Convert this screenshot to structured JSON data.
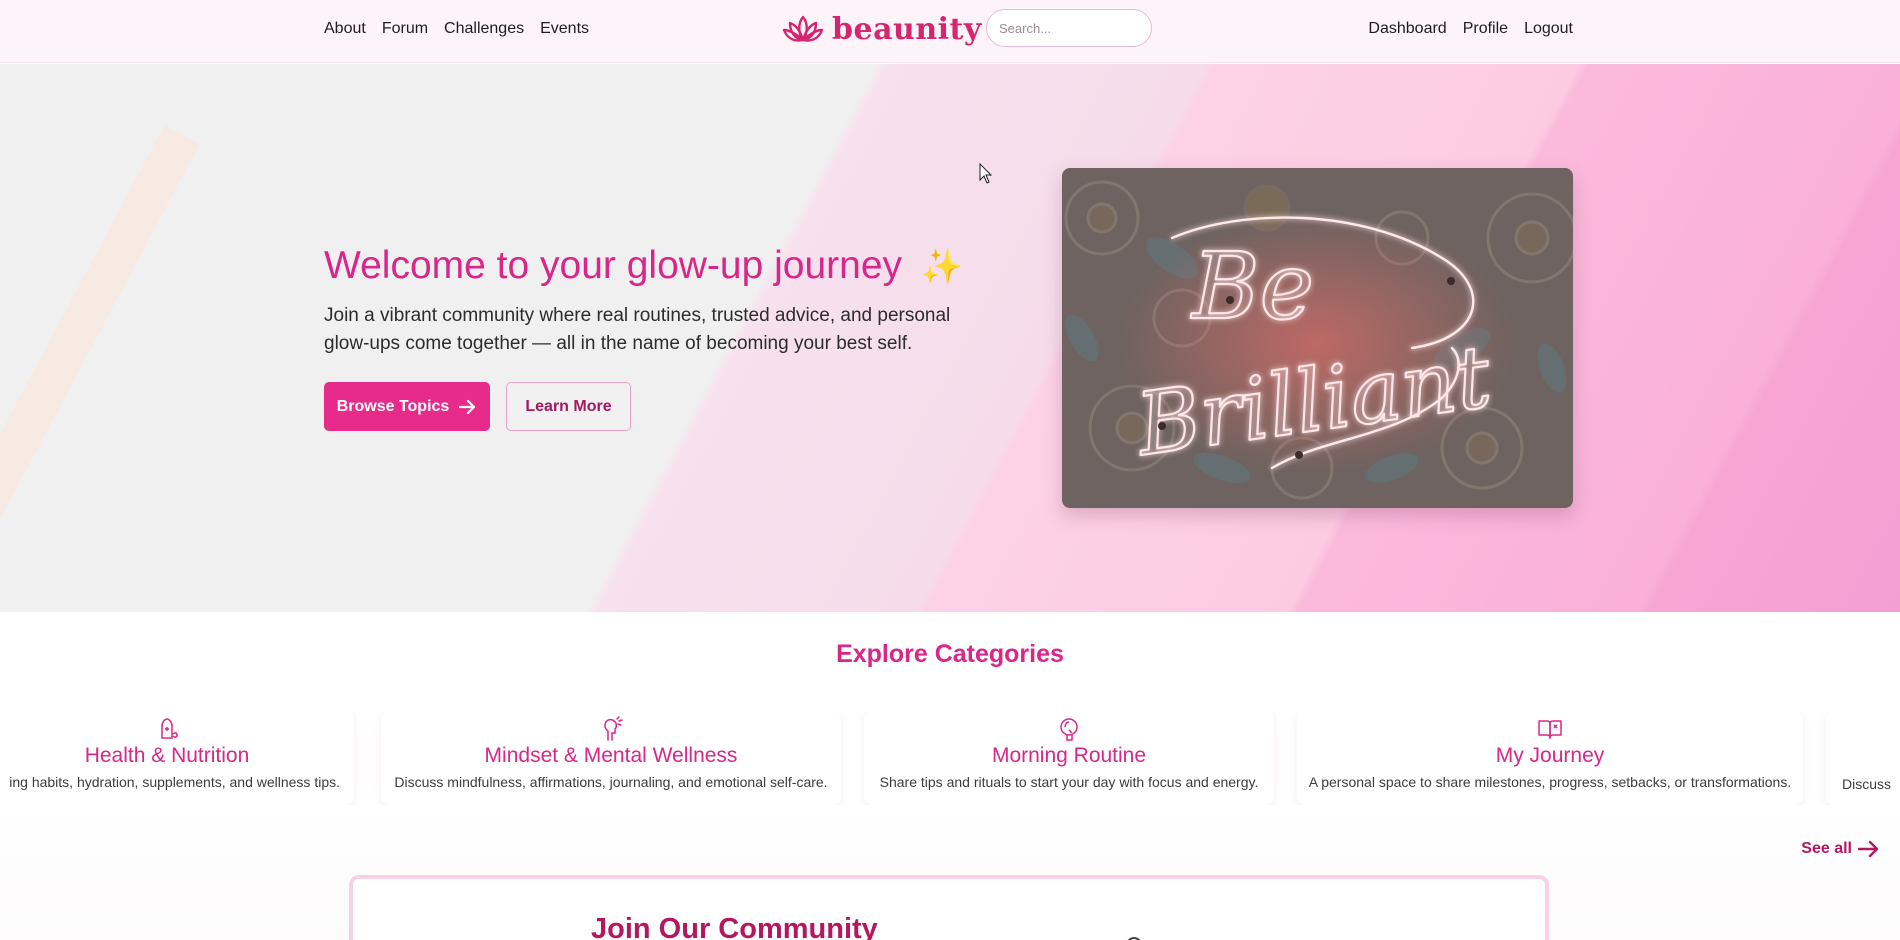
{
  "nav": {
    "left_links": [
      "About",
      "Forum",
      "Challenges",
      "Events"
    ],
    "brand": "beaunity",
    "search_placeholder": "Search...",
    "right_links": [
      "Dashboard",
      "Profile",
      "Logout"
    ]
  },
  "hero": {
    "title": "Welcome to your glow-up journey",
    "title_emoji": "✨",
    "subtitle": "Join a vibrant community where real routines, trusted advice, and personal glow-ups come together — all in the name of becoming your best self.",
    "primary_button": "Browse Topics",
    "secondary_button": "Learn More",
    "image_text_1": "Be",
    "image_text_2": "Brilliant"
  },
  "categories": {
    "title": "Explore Categories",
    "items": [
      {
        "icon": "nutrition-icon",
        "title": "Health & Nutrition",
        "desc": "ing habits, hydration, supplements, and wellness tips."
      },
      {
        "icon": "mindset-icon",
        "title": "Mindset & Mental Wellness",
        "desc": "Discuss mindfulness, affirmations, journaling, and emotional self-care."
      },
      {
        "icon": "morning-icon",
        "title": "Morning Routine",
        "desc": "Share tips and rituals to start your day with focus and energy."
      },
      {
        "icon": "book-icon",
        "title": "My Journey",
        "desc": "A personal space to share milestones, progress, setbacks, or transformations."
      },
      {
        "icon": "",
        "title": "",
        "desc": "Discuss"
      }
    ],
    "see_all": "See all"
  },
  "join": {
    "title": "Join Our Community"
  },
  "colors": {
    "accent": "#e62b8b",
    "heading": "#d9268a",
    "deep": "#b5175f"
  }
}
